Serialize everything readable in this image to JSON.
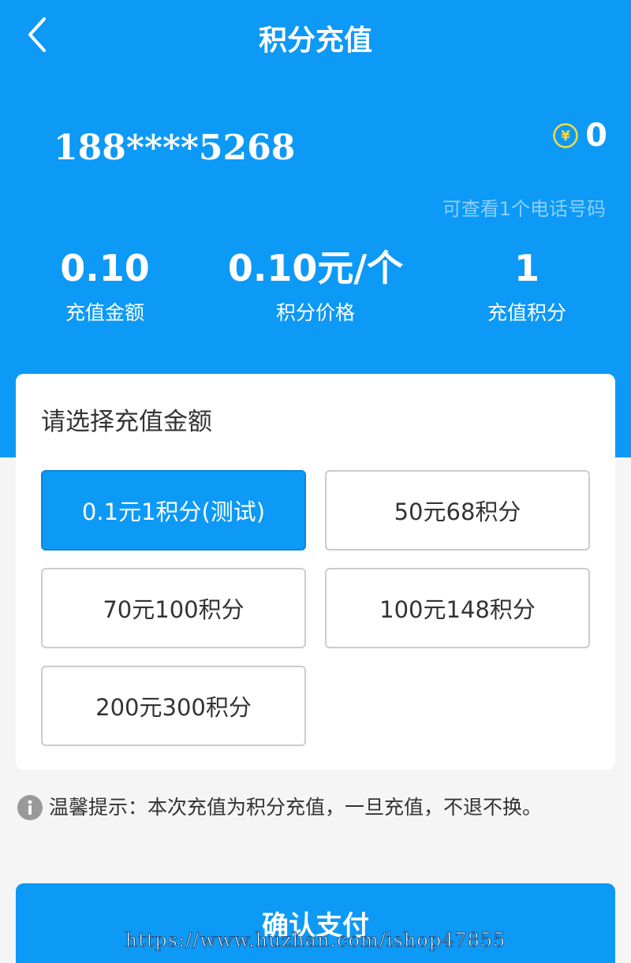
{
  "header": {
    "title": "积分充值",
    "back_icon": "chevron-left-icon"
  },
  "account": {
    "phone": "188****5268",
    "coin_icon": "yen-coin-icon",
    "balance": "0",
    "hint": "可查看1个电话号码"
  },
  "stats": [
    {
      "value": "0.10",
      "label": "充值金额"
    },
    {
      "value": "0.10元/个",
      "label": "积分价格"
    },
    {
      "value": "1",
      "label": "充值积分"
    }
  ],
  "select": {
    "title": "请选择充值金额",
    "options": [
      {
        "label": "0.1元1积分(测试)",
        "selected": true
      },
      {
        "label": "50元68积分",
        "selected": false
      },
      {
        "label": "70元100积分",
        "selected": false
      },
      {
        "label": "100元148积分",
        "selected": false
      },
      {
        "label": "200元300积分",
        "selected": false
      }
    ]
  },
  "notice": {
    "icon": "info-icon",
    "text": "温馨提示：本次充值为积分充值，一旦充值，不退不换。"
  },
  "confirm": {
    "label": "确认支付"
  },
  "watermark": "https://www.huzhan.com/ishop47855",
  "colors": {
    "primary": "#0d99f6",
    "coin": "#ffd93b",
    "hint": "#8fd0fb"
  }
}
